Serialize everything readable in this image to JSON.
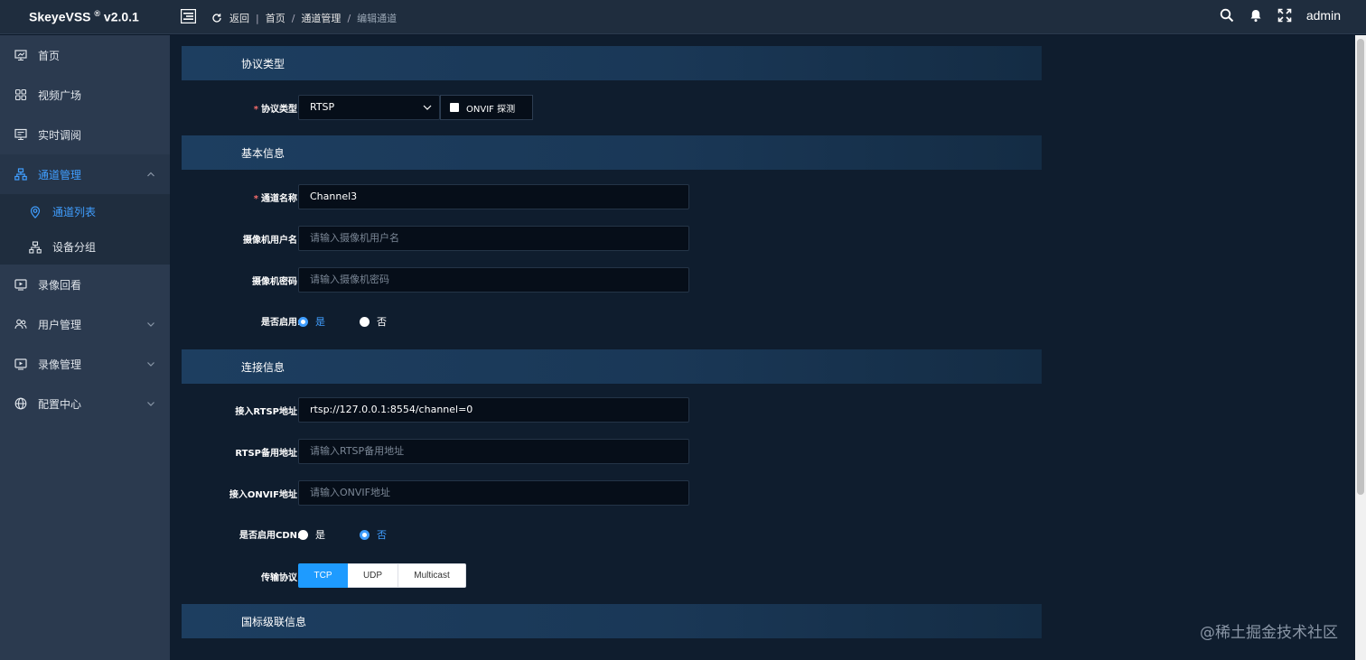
{
  "app": {
    "name": "SkeyeVSS",
    "reg": "®",
    "version": "v2.0.1"
  },
  "breadcrumb": {
    "back": "返回",
    "home": "首页",
    "section": "通道管理",
    "current": "编辑通道"
  },
  "user": {
    "name": "admin"
  },
  "sidebar": {
    "items": [
      {
        "label": "首页",
        "icon": "monitor-icon"
      },
      {
        "label": "视频广场",
        "icon": "grid-icon"
      },
      {
        "label": "实时调阅",
        "icon": "screen-icon"
      },
      {
        "label": "通道管理",
        "icon": "sitemap-icon"
      },
      {
        "label": "录像回看",
        "icon": "playback-icon"
      },
      {
        "label": "用户管理",
        "icon": "users-icon"
      },
      {
        "label": "录像管理",
        "icon": "record-icon"
      },
      {
        "label": "配置中心",
        "icon": "globe-icon"
      }
    ],
    "sub_items": [
      {
        "label": "通道列表",
        "icon": "location-icon"
      },
      {
        "label": "设备分组",
        "icon": "org-icon"
      }
    ]
  },
  "sections": {
    "protocol": "协议类型",
    "basic": "基本信息",
    "connection": "连接信息",
    "national": "国标级联信息"
  },
  "form": {
    "protocol_label": "协议类型:",
    "protocol_value": "RTSP",
    "onvif_label": "ONVIF 探测",
    "channel_name_label": "通道名称:",
    "channel_name_value": "Channel3",
    "cam_user_label": "摄像机用户名:",
    "cam_user_placeholder": "请输入摄像机用户名",
    "cam_pwd_label": "摄像机密码:",
    "cam_pwd_placeholder": "请输入摄像机密码",
    "enabled_label": "是否启用:",
    "yes": "是",
    "no": "否",
    "rtsp_label": "接入RTSP地址:",
    "rtsp_value": "rtsp://127.0.0.1:8554/channel=0",
    "rtsp_backup_label": "RTSP备用地址:",
    "rtsp_backup_placeholder": "请输入RTSP备用地址",
    "onvif_addr_label": "接入ONVIF地址:",
    "onvif_addr_placeholder": "请输入ONVIF地址",
    "cdn_label": "是否启用CDN:",
    "transport_label": "传输协议:",
    "transport_options": [
      "TCP",
      "UDP",
      "Multicast"
    ]
  },
  "watermark": "@稀土掘金技术社区",
  "colors": {
    "accent": "#409eff",
    "required": "#f56c6c",
    "header_bg": "#1f2d3e",
    "sidebar_bg": "#2b3a4f"
  }
}
